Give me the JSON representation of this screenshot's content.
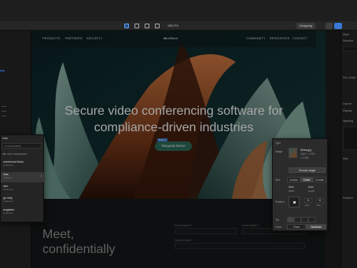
{
  "toolbar": {
    "canvas_size": "1921 PX",
    "mode_label": "Designing"
  },
  "site": {
    "brand": "MeetSure",
    "nav_left": [
      "PRODUCTS",
      "PARTNERS",
      "SECURITY"
    ],
    "nav_right": [
      "COMMUNITY",
      "RESOURCES",
      "CONTACT"
    ],
    "hero_title_line1": "Secure video conferencing software for",
    "hero_title_line2": "compliance-driven industries",
    "selected_badge": "Button",
    "cta_label": "Request Demo",
    "section_title_line1": "Meet,",
    "section_title_line2": "confidentially",
    "form": {
      "first_name_label": "First Name *",
      "last_name_label": "Last Name *",
      "work_email_label": "Work Email *"
    }
  },
  "navigator": {
    "title": "ents",
    "search_placeholder": "d components",
    "create_label": "ate new component",
    "items": [
      {
        "title": "ommercial block",
        "subtitle": "instances",
        "selected": false
      },
      {
        "title": "ntas",
        "subtitle": "instance",
        "selected": true
      },
      {
        "title": "oter",
        "subtitle": "instances",
        "selected": false
      },
      {
        "title": "go strip",
        "subtitle": "instances",
        "selected": false
      },
      {
        "title": "avigation",
        "subtitle": "instances",
        "selected": false
      }
    ],
    "check_icon": "✓"
  },
  "rightpanel": {
    "style_label": "Style",
    "style_sel": "Selector",
    "child_label": "Flex Child",
    "layout_label": "Layout",
    "display_label": "Display",
    "spacing_label": "Spacing",
    "size_label": "Size",
    "position_label": "Position"
  },
  "image_settings": {
    "type_label": "Type",
    "image_label": "Image",
    "file_name": "Wires.jpg",
    "file_dims": "3840 × 2160",
    "file_size": "1.2 MB",
    "choose_label": "Choose image",
    "size_label": "Size",
    "size_options": [
      "Custom",
      "Cover",
      "Contain"
    ],
    "size_active": "Cover",
    "width_label": "Width",
    "height_label": "Height",
    "width_value": "Auto",
    "height_value": "Auto",
    "position_label": "Position",
    "pos_left": "Left",
    "pos_top": "Top",
    "pos_x": "50",
    "pos_y": "50",
    "tile_label": "Tile",
    "fixed_label": "Fixed",
    "fixed_options": [
      "Fixed",
      "Not fixed"
    ],
    "fixed_active": "Not fixed"
  },
  "colors": {
    "accent": "#3a78d6",
    "cta": "#2f6e5b",
    "hero_teal": "#2f5752",
    "hero_copper": "#b35a2a"
  }
}
